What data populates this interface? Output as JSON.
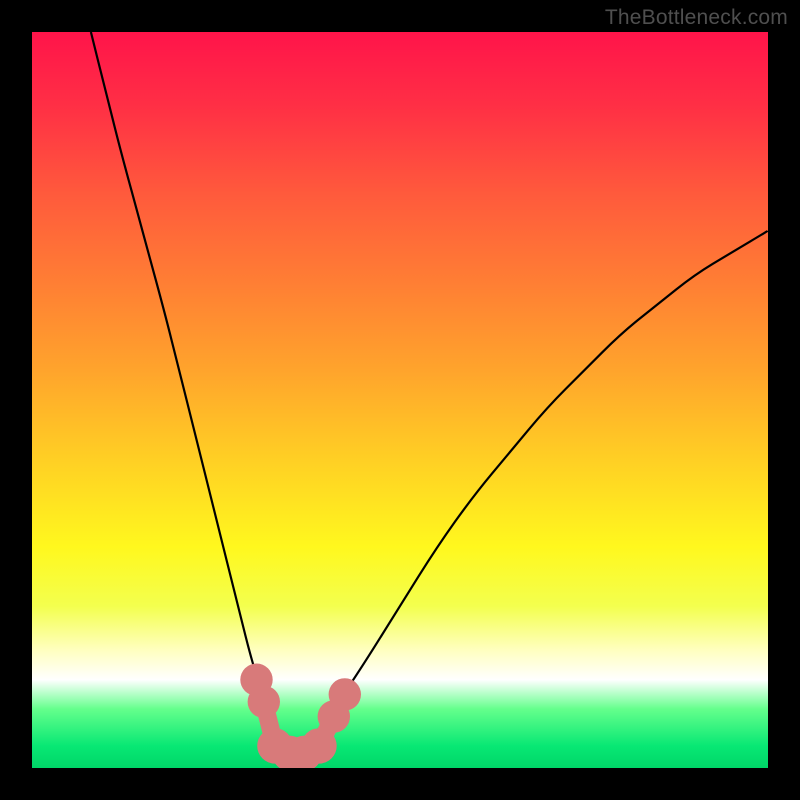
{
  "watermark": "TheBottleneck.com",
  "chart_data": {
    "type": "line",
    "title": "",
    "xlabel": "",
    "ylabel": "",
    "xlim": [
      0,
      100
    ],
    "ylim": [
      0,
      100
    ],
    "grid": false,
    "legend": false,
    "background_gradient": {
      "direction": "vertical",
      "stops": [
        {
          "pos": 0,
          "color": "#ff144a"
        },
        {
          "pos": 50,
          "color": "#ffcf24"
        },
        {
          "pos": 88,
          "color": "#ffffff"
        },
        {
          "pos": 100,
          "color": "#00d668"
        }
      ]
    },
    "series": [
      {
        "name": "bottleneck-curve",
        "color": "#000000",
        "x": [
          8,
          10,
          12,
          15,
          18,
          20,
          22,
          25,
          28,
          30,
          32,
          33,
          34,
          36,
          38,
          41,
          45,
          50,
          55,
          60,
          65,
          70,
          75,
          80,
          85,
          90,
          95,
          100
        ],
        "values": [
          100,
          92,
          84,
          73,
          62,
          54,
          46,
          34,
          22,
          14,
          8,
          4,
          2,
          2,
          4,
          8,
          14,
          22,
          30,
          37,
          43,
          49,
          54,
          59,
          63,
          67,
          70,
          73
        ]
      }
    ],
    "markers": [
      {
        "name": "marker-left-1",
        "x": 30.5,
        "y": 12,
        "color": "#d87a7a",
        "r": 2.2
      },
      {
        "name": "marker-left-2",
        "x": 31.5,
        "y": 9,
        "color": "#d87a7a",
        "r": 2.2
      },
      {
        "name": "marker-trough-1",
        "x": 33,
        "y": 3,
        "color": "#d87a7a",
        "r": 2.4
      },
      {
        "name": "marker-trough-2",
        "x": 35,
        "y": 2,
        "color": "#d87a7a",
        "r": 2.4
      },
      {
        "name": "marker-trough-3",
        "x": 37,
        "y": 2,
        "color": "#d87a7a",
        "r": 2.4
      },
      {
        "name": "marker-trough-4",
        "x": 39,
        "y": 3,
        "color": "#d87a7a",
        "r": 2.4
      },
      {
        "name": "marker-right-1",
        "x": 41,
        "y": 7,
        "color": "#d87a7a",
        "r": 2.2
      },
      {
        "name": "marker-right-2",
        "x": 42.5,
        "y": 10,
        "color": "#d87a7a",
        "r": 2.2
      }
    ]
  }
}
